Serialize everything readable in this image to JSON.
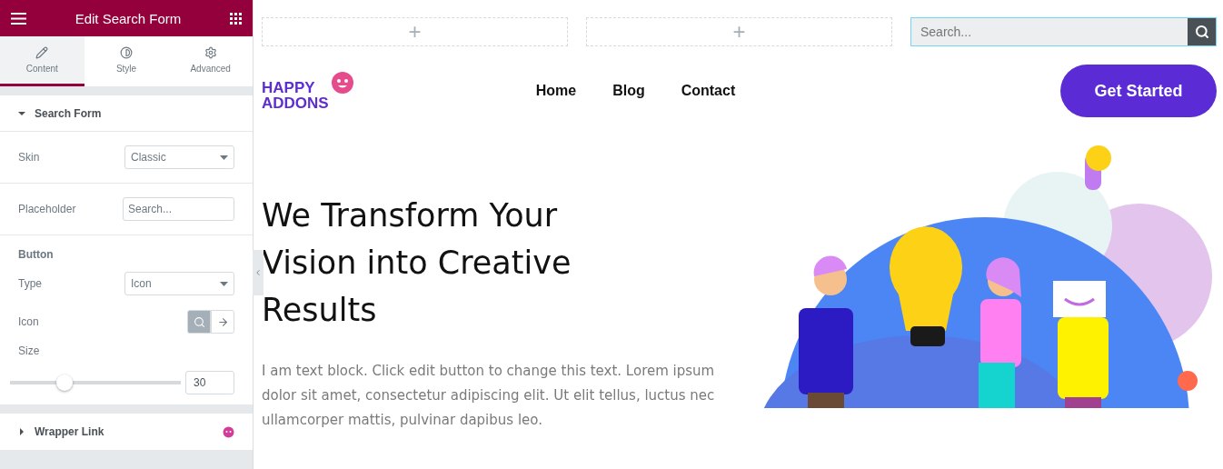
{
  "panel": {
    "title": "Edit Search Form",
    "tabs": [
      {
        "label": "Content",
        "kind": "content",
        "selected": true
      },
      {
        "label": "Style",
        "kind": "style",
        "selected": false
      },
      {
        "label": "Advanced",
        "kind": "advanced",
        "selected": false
      }
    ],
    "sections": [
      {
        "title": "Search Form",
        "expanded": true,
        "kind": "form"
      },
      {
        "title": "Wrapper Link",
        "expanded": false,
        "kind": "wrapper"
      }
    ],
    "skin": {
      "label": "Skin",
      "value": "Classic"
    },
    "placeholder": {
      "label": "Placeholder",
      "value": "Search..."
    },
    "button_heading": "Button",
    "type": {
      "label": "Type",
      "value": "Icon"
    },
    "icon": {
      "label": "Icon",
      "options": [
        {
          "kind": "search",
          "selected": true
        },
        {
          "kind": "arrow",
          "selected": false
        }
      ]
    },
    "size": {
      "label": "Size",
      "level": 0.3,
      "value": "30"
    }
  },
  "canvas": {
    "add_columns": [
      "+",
      "+"
    ],
    "search": {
      "placeholder": "Search..."
    },
    "logo": [
      "HAPPY",
      "ADDONS"
    ],
    "nav": [
      "Home",
      "Blog",
      "Contact"
    ],
    "cta": "Get Started",
    "headline": "We Transform Your Vision into Creative Results",
    "body": "I am text block. Click edit button to change this text. Lorem ipsum dolor sit amet, consectetur adipiscing elit. Ut elit tellus, luctus nec ullamcorper mattis, pulvinar dapibus leo."
  }
}
